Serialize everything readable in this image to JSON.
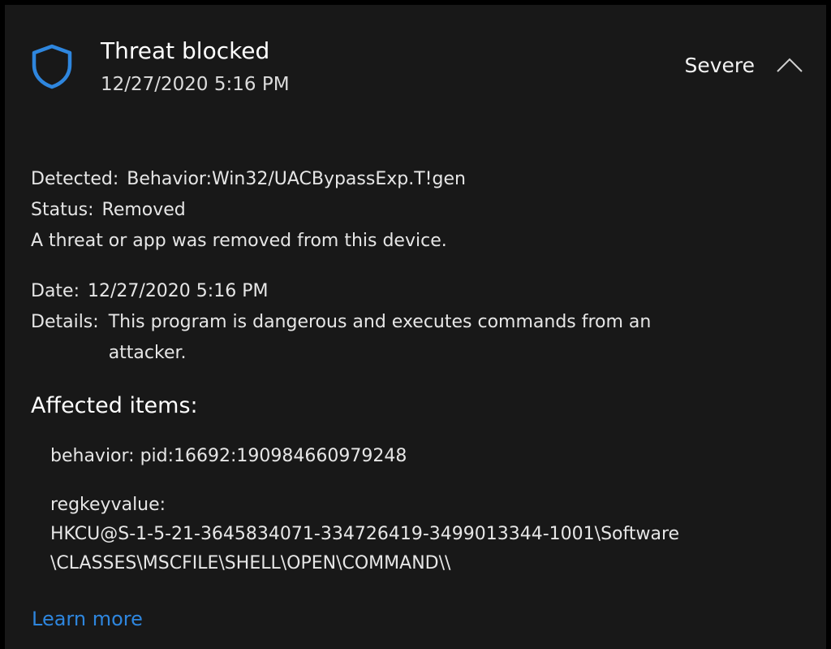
{
  "header": {
    "title": "Threat blocked",
    "timestamp": "12/27/2020 5:16 PM",
    "severity": "Severe",
    "shield_icon": "shield-icon",
    "chevron_icon": "chevron-up-icon"
  },
  "details": {
    "detected_label": "Detected:",
    "detected_value": "Behavior:Win32/UACBypassExp.T!gen",
    "status_label": "Status:",
    "status_value": "Removed",
    "status_message": "A threat or app was removed from this device.",
    "date_label": "Date:",
    "date_value": "12/27/2020 5:16 PM",
    "details_label": "Details:",
    "details_value": "This program is dangerous and executes commands from an attacker."
  },
  "affected": {
    "title": "Affected items:",
    "items": [
      {
        "line1": "behavior: pid:16692:190984660979248"
      },
      {
        "line1": "regkeyvalue:",
        "line2": "HKCU@S-1-5-21-3645834071-334726419-3499013344-1001\\Software",
        "line3": "\\CLASSES\\MSCFILE\\SHELL\\OPEN\\COMMAND\\\\"
      }
    ]
  },
  "learn_more": "Learn more",
  "colors": {
    "background": "#181818",
    "accent": "#2e86de",
    "text": "#f2f2f2"
  }
}
